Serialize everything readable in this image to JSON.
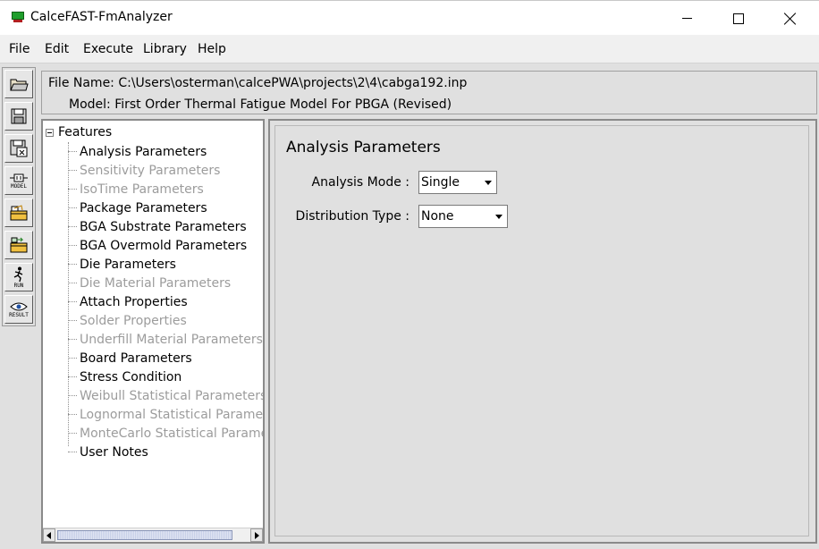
{
  "window": {
    "title": "CalceFAST-FmAnalyzer"
  },
  "menu": {
    "items": [
      "File",
      "Edit",
      "Execute",
      "Library",
      "Help"
    ]
  },
  "toolbar": {
    "buttons": [
      {
        "icon": "open-folder-icon",
        "label": ""
      },
      {
        "icon": "save-disk-icon",
        "label": ""
      },
      {
        "icon": "save-as-icon",
        "label": ""
      },
      {
        "icon": "model-icon",
        "label": "MODEL"
      },
      {
        "icon": "open-library-icon",
        "label": ""
      },
      {
        "icon": "import-library-icon",
        "label": ""
      },
      {
        "icon": "run-icon",
        "label": "RUN"
      },
      {
        "icon": "result-eye-icon",
        "label": "RESULT"
      }
    ]
  },
  "info": {
    "file_line": "File Name: C:\\Users\\osterman\\calcePWA\\projects\\2\\4\\cabga192.inp",
    "model_line": "Model: First Order Thermal Fatigue Model For PBGA (Revised)"
  },
  "tree": {
    "root": "Features",
    "items": [
      {
        "label": "Analysis Parameters",
        "enabled": true
      },
      {
        "label": "Sensitivity Parameters",
        "enabled": false
      },
      {
        "label": "IsoTime Parameters",
        "enabled": false
      },
      {
        "label": "Package Parameters",
        "enabled": true
      },
      {
        "label": "BGA Substrate Parameters",
        "enabled": true
      },
      {
        "label": "BGA Overmold Parameters",
        "enabled": true
      },
      {
        "label": "Die Parameters",
        "enabled": true
      },
      {
        "label": "Die Material Parameters",
        "enabled": false
      },
      {
        "label": "Attach Properties",
        "enabled": true
      },
      {
        "label": "Solder Properties",
        "enabled": false
      },
      {
        "label": "Underfill Material Parameters",
        "enabled": false
      },
      {
        "label": "Board Parameters",
        "enabled": true
      },
      {
        "label": "Stress Condition",
        "enabled": true
      },
      {
        "label": "Weibull Statistical Parameters",
        "enabled": false
      },
      {
        "label": "Lognormal Statistical Parameters",
        "enabled": false
      },
      {
        "label": "MonteCarlo Statistical Parameters",
        "enabled": false
      },
      {
        "label": "User Notes",
        "enabled": true
      }
    ]
  },
  "content": {
    "title": "Analysis Parameters",
    "analysis_mode": {
      "label": "Analysis Mode :",
      "value": "Single"
    },
    "distribution_type": {
      "label": "Distribution Type :",
      "value": "None"
    }
  }
}
